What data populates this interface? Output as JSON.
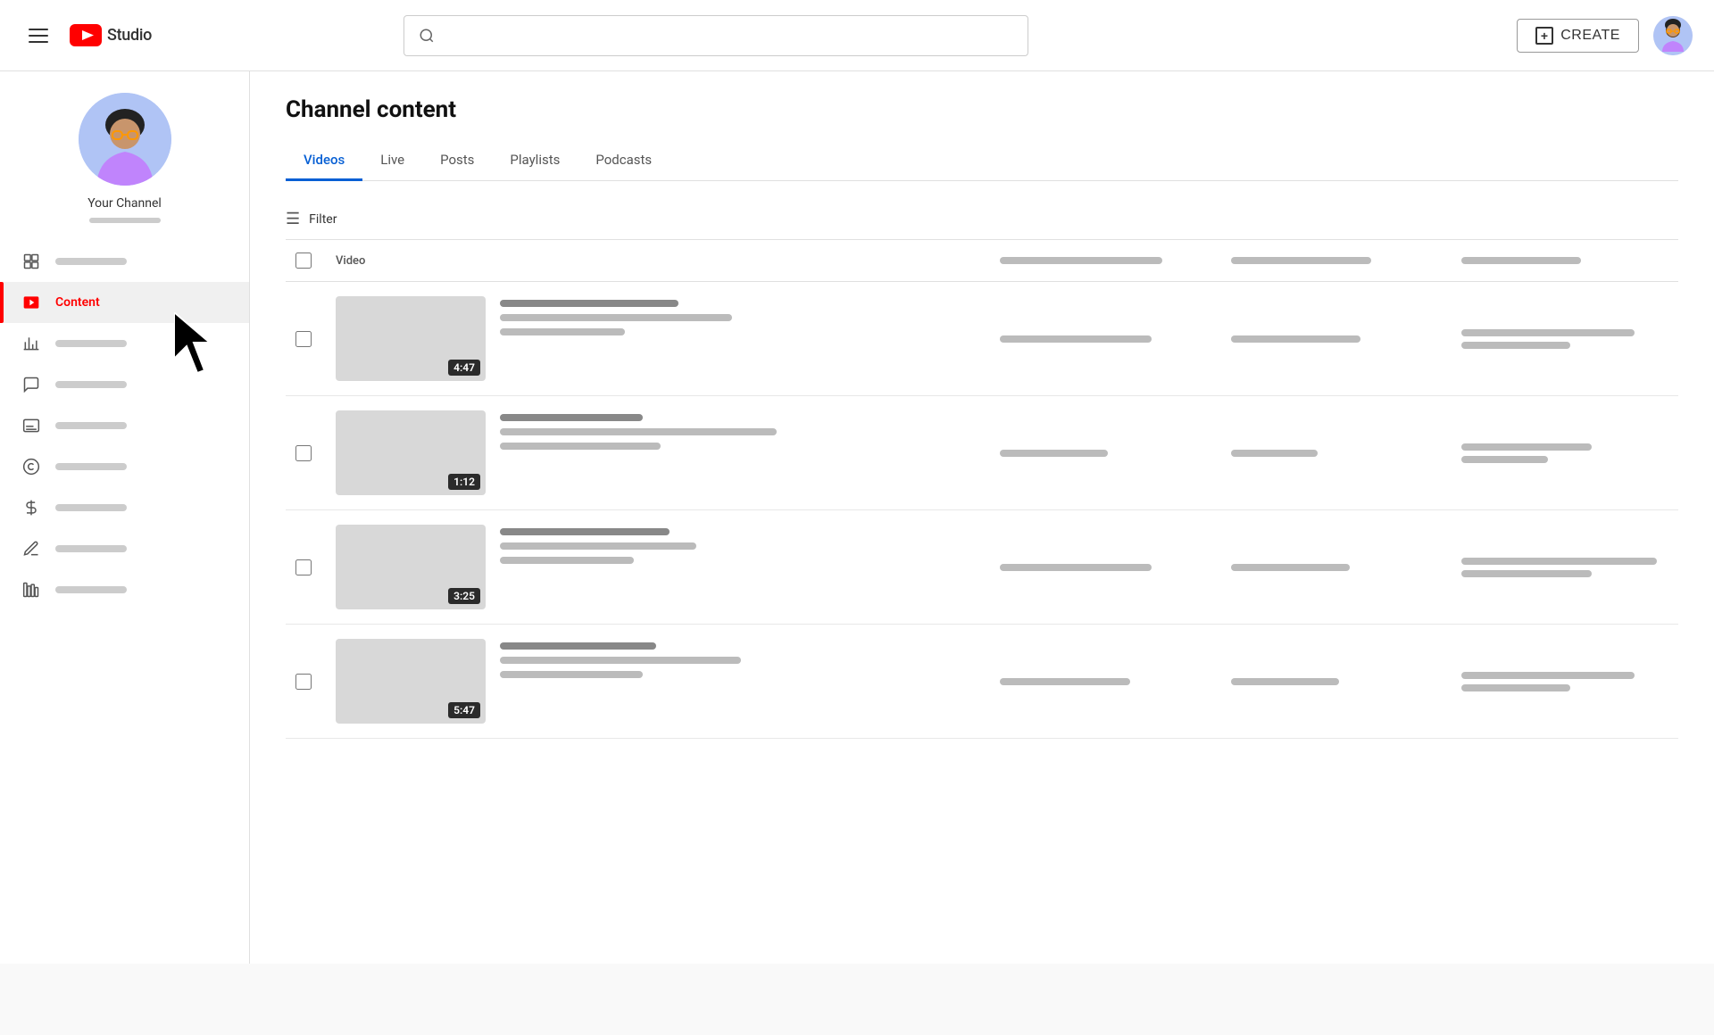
{
  "header": {
    "menu_label": "Menu",
    "logo_text": "Studio",
    "search_placeholder": "",
    "create_label": "CREATE",
    "avatar_label": "User Avatar"
  },
  "sidebar": {
    "channel_name": "Your Channel",
    "items": [
      {
        "id": "dashboard",
        "label": "",
        "icon": "dashboard"
      },
      {
        "id": "content",
        "label": "Content",
        "icon": "content",
        "active": true
      },
      {
        "id": "analytics",
        "label": "",
        "icon": "analytics"
      },
      {
        "id": "comments",
        "label": "",
        "icon": "comments"
      },
      {
        "id": "subtitles",
        "label": "",
        "icon": "subtitles"
      },
      {
        "id": "copyright",
        "label": "",
        "icon": "copyright"
      },
      {
        "id": "monetization",
        "label": "",
        "icon": "monetization"
      },
      {
        "id": "customization",
        "label": "",
        "icon": "customization"
      },
      {
        "id": "audio",
        "label": "",
        "icon": "audio"
      }
    ]
  },
  "main": {
    "page_title": "Channel content",
    "tabs": [
      {
        "label": "Videos",
        "active": true
      },
      {
        "label": "Live",
        "active": false
      },
      {
        "label": "Posts",
        "active": false
      },
      {
        "label": "Playlists",
        "active": false
      },
      {
        "label": "Podcasts",
        "active": false
      }
    ],
    "filter_label": "Filter",
    "table": {
      "header_video_label": "Video",
      "videos": [
        {
          "duration": "4:47"
        },
        {
          "duration": "1:12"
        },
        {
          "duration": "3:25"
        },
        {
          "duration": "5:47"
        }
      ]
    }
  }
}
